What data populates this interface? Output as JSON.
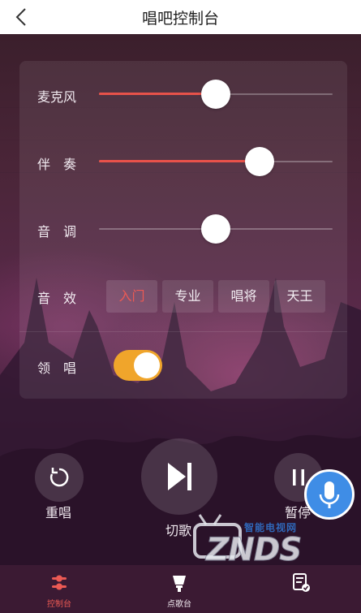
{
  "header": {
    "title": "唱吧控制台",
    "back_icon": "chevron-left-icon"
  },
  "controls": {
    "mic": {
      "label": "麦克风",
      "value": 0.5
    },
    "accomp": {
      "label": "伴　奏",
      "value": 0.75
    },
    "pitch": {
      "label": "音　调",
      "value": 0.5
    },
    "effects": {
      "label": "音　效",
      "options": [
        "入门",
        "专业",
        "唱将",
        "天王"
      ],
      "selected": "入门"
    },
    "lead": {
      "label": "领　唱",
      "enabled": true
    }
  },
  "playback": {
    "replay_label": "重唱",
    "next_label": "切歌",
    "pause_label": "暂停",
    "mic_icon": "microphone-icon"
  },
  "watermark": {
    "small": "智能电视网",
    "big": "ZNDS"
  },
  "tabs": [
    {
      "label": "控制台",
      "icon": "control-panel-icon",
      "active": true
    },
    {
      "label": "点歌台",
      "icon": "microphone-stand-icon",
      "active": false
    },
    {
      "label": "",
      "icon": "song-list-icon",
      "active": false
    }
  ],
  "colors": {
    "accent": "#e8524a",
    "toggle_on": "#f0a52b",
    "mic_button": "#3f8de6"
  }
}
